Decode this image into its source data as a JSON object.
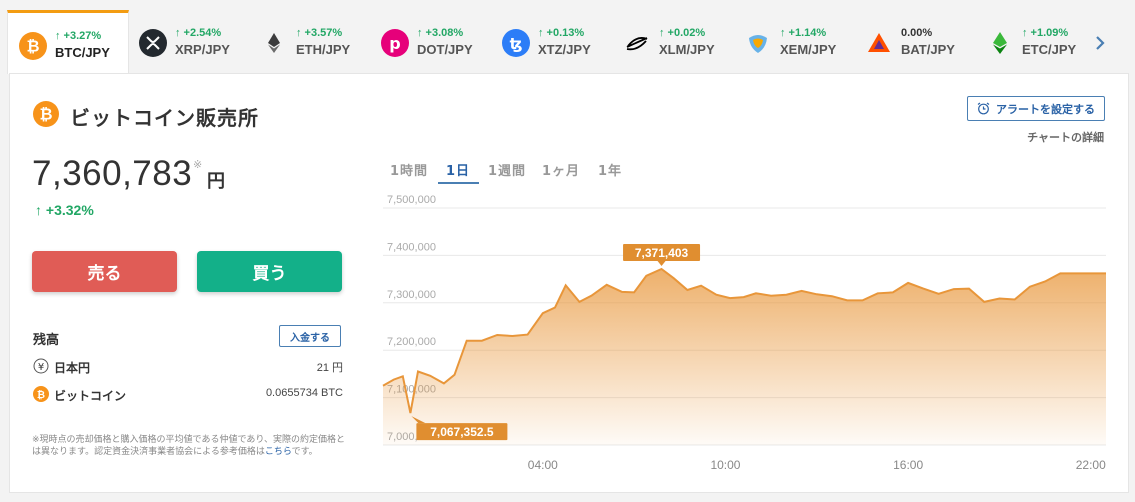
{
  "tickers": [
    {
      "pair": "BTC/JPY",
      "change": "+3.27%",
      "icon": "bitcoin-icon",
      "color": "#f7931a",
      "active": true
    },
    {
      "pair": "XRP/JPY",
      "change": "+2.54%",
      "icon": "xrp-icon",
      "color": "#23292f"
    },
    {
      "pair": "ETH/JPY",
      "change": "+3.57%",
      "icon": "ethereum-icon",
      "color": "#3c3c3d"
    },
    {
      "pair": "DOT/JPY",
      "change": "+3.08%",
      "icon": "polkadot-icon",
      "color": "#e6007a"
    },
    {
      "pair": "XTZ/JPY",
      "change": "+0.13%",
      "icon": "tezos-icon",
      "color": "#2c7df7"
    },
    {
      "pair": "XLM/JPY",
      "change": "+0.02%",
      "icon": "stellar-icon",
      "color": "#000000"
    },
    {
      "pair": "XEM/JPY",
      "change": "+1.14%",
      "icon": "nem-icon",
      "color": "#67b2e8"
    },
    {
      "pair": "BAT/JPY",
      "change": "0.00%",
      "icon": "bat-icon",
      "color": "#ff5000"
    },
    {
      "pair": "ETC/JPY",
      "change": "+1.09%",
      "icon": "ethereum-classic-icon",
      "color": "#3ab83a"
    }
  ],
  "title": "ビットコイン販売所",
  "price": {
    "value": "7,360,783",
    "note": "※",
    "unit": "円",
    "change": "+3.32%"
  },
  "actions": {
    "sell": "売る",
    "buy": "買う"
  },
  "balance": {
    "title": "残高",
    "deposit": "入金する",
    "rows": [
      {
        "name": "日本円",
        "value": "21 円",
        "icon": "yen-icon"
      },
      {
        "name": "ビットコイン",
        "value": "0.0655734 BTC",
        "icon": "bitcoin-icon"
      }
    ]
  },
  "disclaimer": {
    "text": "※現時点の売却価格と購入価格の平均値である仲値であり、実際の約定価格とは異なります。認定資金決済事業者協会による参考価格は",
    "link": "こちら",
    "suffix": "です。"
  },
  "alert_button": "アラートを設定する",
  "chart_detail": "チャートの詳細",
  "periods": [
    "1時間",
    "1日",
    "1週間",
    "1ヶ月",
    "1年"
  ],
  "active_period": "1日",
  "colors": {
    "accent": "#f39c12",
    "positive": "#22a765",
    "sell": "#e05c56",
    "buy": "#13b089",
    "link": "#2a62a6",
    "chart_line": "#e8963a"
  },
  "chart_data": {
    "type": "area",
    "ylim": [
      7000000,
      7500000
    ],
    "y_ticks": [
      "7,500,000",
      "7,400,000",
      "7,300,000",
      "7,200,000",
      "7,100,000",
      "7,000,000"
    ],
    "y_tick_values": [
      7500000,
      7400000,
      7300000,
      7200000,
      7100000,
      7000000
    ],
    "x_ticks": [
      "04:00",
      "10:00",
      "16:00",
      "22:00"
    ],
    "x_tick_positions": [
      4,
      10,
      16,
      22
    ],
    "xlim": [
      -1.25,
      22.5
    ],
    "max_label": "7,371,403",
    "min_label": "7,067,352.5",
    "max_value": 7371403,
    "min_value": 7067352.5,
    "x": [
      -1.25,
      -0.9,
      -0.6,
      -0.35,
      -0.1,
      0.3,
      0.75,
      1.1,
      1.5,
      2.0,
      2.5,
      3.0,
      3.5,
      4.0,
      4.4,
      4.75,
      5.2,
      5.6,
      6.1,
      6.6,
      7.0,
      7.4,
      7.9,
      8.3,
      8.75,
      9.2,
      9.7,
      10.15,
      10.6,
      11.0,
      11.5,
      12.0,
      12.5,
      13.0,
      13.5,
      14.0,
      14.5,
      15.0,
      15.5,
      16.0,
      16.5,
      17.0,
      17.5,
      18.0,
      18.5,
      19.0,
      19.5,
      20.0,
      20.5,
      21.0,
      21.5,
      22.0,
      22.5
    ],
    "y": [
      7125000,
      7138000,
      7145000,
      7067352,
      7155000,
      7146000,
      7130000,
      7148000,
      7220000,
      7220000,
      7232000,
      7230000,
      7233000,
      7278000,
      7290000,
      7337000,
      7302000,
      7315000,
      7338000,
      7323000,
      7322000,
      7357000,
      7371403,
      7352000,
      7327000,
      7336000,
      7317000,
      7310000,
      7312000,
      7320000,
      7315000,
      7317000,
      7325000,
      7318000,
      7314000,
      7305000,
      7305000,
      7320000,
      7322000,
      7342000,
      7330000,
      7319000,
      7329000,
      7330000,
      7302000,
      7309000,
      7307000,
      7334000,
      7345000,
      7362000,
      7362000,
      7362000,
      7362000
    ]
  }
}
